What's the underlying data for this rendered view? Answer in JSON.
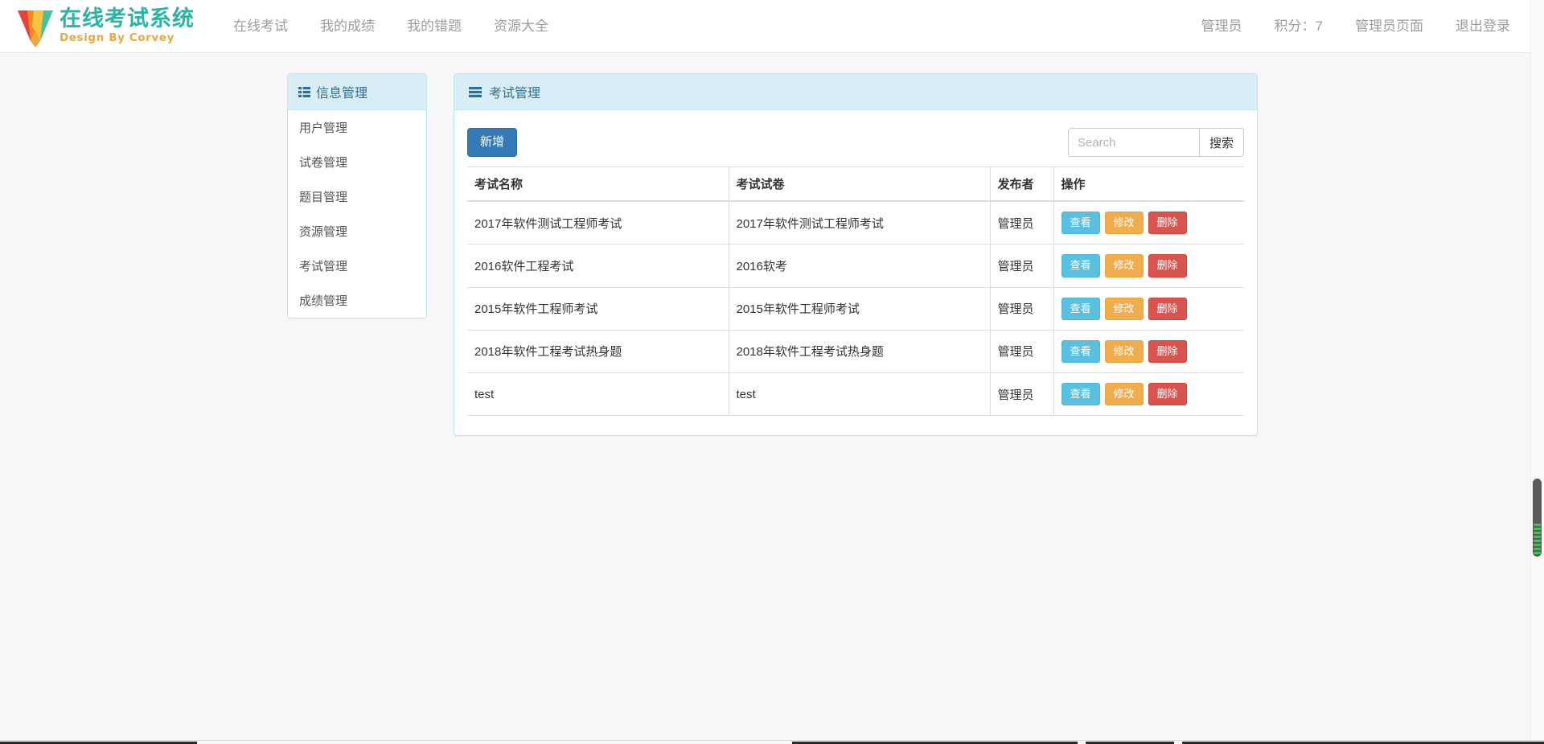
{
  "brand": {
    "title": "在线考试系统",
    "subtitle": "Design By Corvey",
    "logo_icon": "chevron-v-logo-icon",
    "colors": {
      "title": "#2bb3a3",
      "subtitle": "#f0a63c",
      "logo_red": "#e8413c",
      "logo_green": "#46c2a0",
      "logo_yellow": "#f6c342",
      "logo_orange": "#f08c1e"
    }
  },
  "nav": {
    "left_items": [
      {
        "label": "在线考试"
      },
      {
        "label": "我的成绩"
      },
      {
        "label": "我的错题"
      },
      {
        "label": "资源大全"
      }
    ],
    "right_items": [
      {
        "label": "管理员"
      },
      {
        "label": "积分：7"
      },
      {
        "label": "管理员页面"
      },
      {
        "label": "退出登录"
      }
    ]
  },
  "sidebar": {
    "header": {
      "title": "信息管理",
      "icon": "list-icon"
    },
    "items": [
      {
        "label": "用户管理"
      },
      {
        "label": "试卷管理"
      },
      {
        "label": "题目管理"
      },
      {
        "label": "资源管理"
      },
      {
        "label": "考试管理"
      },
      {
        "label": "成绩管理"
      }
    ]
  },
  "panel": {
    "header": {
      "title": "考试管理",
      "icon": "align-justify-icon"
    },
    "toolbar": {
      "add_label": "新增",
      "search_placeholder": "Search",
      "search_value": "",
      "search_button_label": "搜索",
      "search_icon": "search-icon"
    },
    "table": {
      "columns": [
        "考试名称",
        "考试试卷",
        "发布者",
        "操作"
      ],
      "rows": [
        {
          "name": "2017年软件测试工程师考试",
          "paper": "2017年软件测试工程师考试",
          "publisher": "管理员",
          "actions": [
            "查看",
            "修改",
            "删除"
          ]
        },
        {
          "name": "2016软件工程考试",
          "paper": "2016软考",
          "publisher": "管理员",
          "actions": [
            "查看",
            "修改",
            "删除"
          ]
        },
        {
          "name": "2015年软件工程师考试",
          "paper": "2015年软件工程师考试",
          "publisher": "管理员",
          "actions": [
            "查看",
            "修改",
            "删除"
          ]
        },
        {
          "name": "2018年软件工程考试热身题",
          "paper": "2018年软件工程考试热身题",
          "publisher": "管理员",
          "actions": [
            "查看",
            "修改",
            "删除"
          ]
        },
        {
          "name": "test",
          "paper": "test",
          "publisher": "管理员",
          "actions": [
            "查看",
            "修改",
            "删除"
          ]
        }
      ]
    }
  },
  "theme": {
    "panel_head_bg": "#d9edf7",
    "panel_head_text": "#31708f",
    "btn_primary": "#337ab7",
    "btn_info": "#5bc0de",
    "btn_warning": "#f0ad4e",
    "btn_danger": "#d9534f"
  },
  "scrollbar": {
    "name": "page-scrollbar"
  }
}
